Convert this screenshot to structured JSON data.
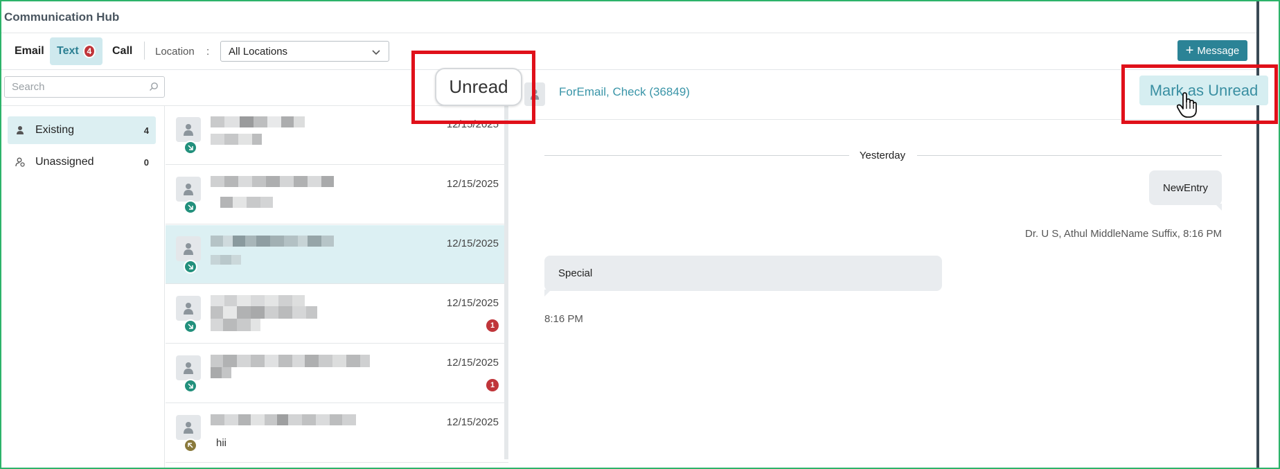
{
  "app": {
    "title": "Communication Hub"
  },
  "toolbar": {
    "tabs": [
      {
        "label": "Email",
        "active": false
      },
      {
        "label": "Text",
        "active": true,
        "badge": "4"
      },
      {
        "label": "Call",
        "active": false
      }
    ],
    "location_label": "Location",
    "location_colon": ":",
    "location_value": "All Locations",
    "message_button": "Message",
    "message_button_icon": "plus-icon"
  },
  "search": {
    "placeholder": "Search",
    "icon": "search-icon"
  },
  "sidebar": {
    "items": [
      {
        "label": "Existing",
        "count": "4",
        "icon": "person-icon",
        "active": true
      },
      {
        "label": "Unassigned",
        "count": "0",
        "icon": "unassigned-person-icon",
        "active": false
      }
    ]
  },
  "conversations": [
    {
      "date": "12/15/2025",
      "direction": "incoming",
      "unread": "",
      "preview": "",
      "selected": false
    },
    {
      "date": "12/15/2025",
      "direction": "incoming",
      "unread": "",
      "preview": "",
      "selected": false
    },
    {
      "date": "12/15/2025",
      "direction": "incoming",
      "unread": "",
      "preview": "",
      "selected": true
    },
    {
      "date": "12/15/2025",
      "direction": "incoming",
      "unread": "1",
      "preview": "",
      "selected": false
    },
    {
      "date": "12/15/2025",
      "direction": "incoming",
      "unread": "1",
      "preview": "",
      "selected": false
    },
    {
      "date": "12/15/2025",
      "direction": "outgoing",
      "unread": "",
      "preview": "hii",
      "selected": false
    }
  ],
  "chat": {
    "contact": "ForEmail, Check (36849)",
    "mark_unread_button": "Mark as Unread",
    "day_divider": "Yesterday",
    "messages": [
      {
        "side": "out",
        "text": "NewEntry",
        "meta": "Dr. U S, Athul MiddleName Suffix, 8:16 PM"
      },
      {
        "side": "in",
        "text": "Special",
        "meta": "8:16 PM"
      }
    ]
  },
  "callout": {
    "label": "Unread",
    "highlight_color": "#e0101a"
  },
  "colors": {
    "accent": "#2b8396",
    "badge": "#c0353a",
    "link": "#3a95a8",
    "selected_bg": "#dcf0f3"
  }
}
